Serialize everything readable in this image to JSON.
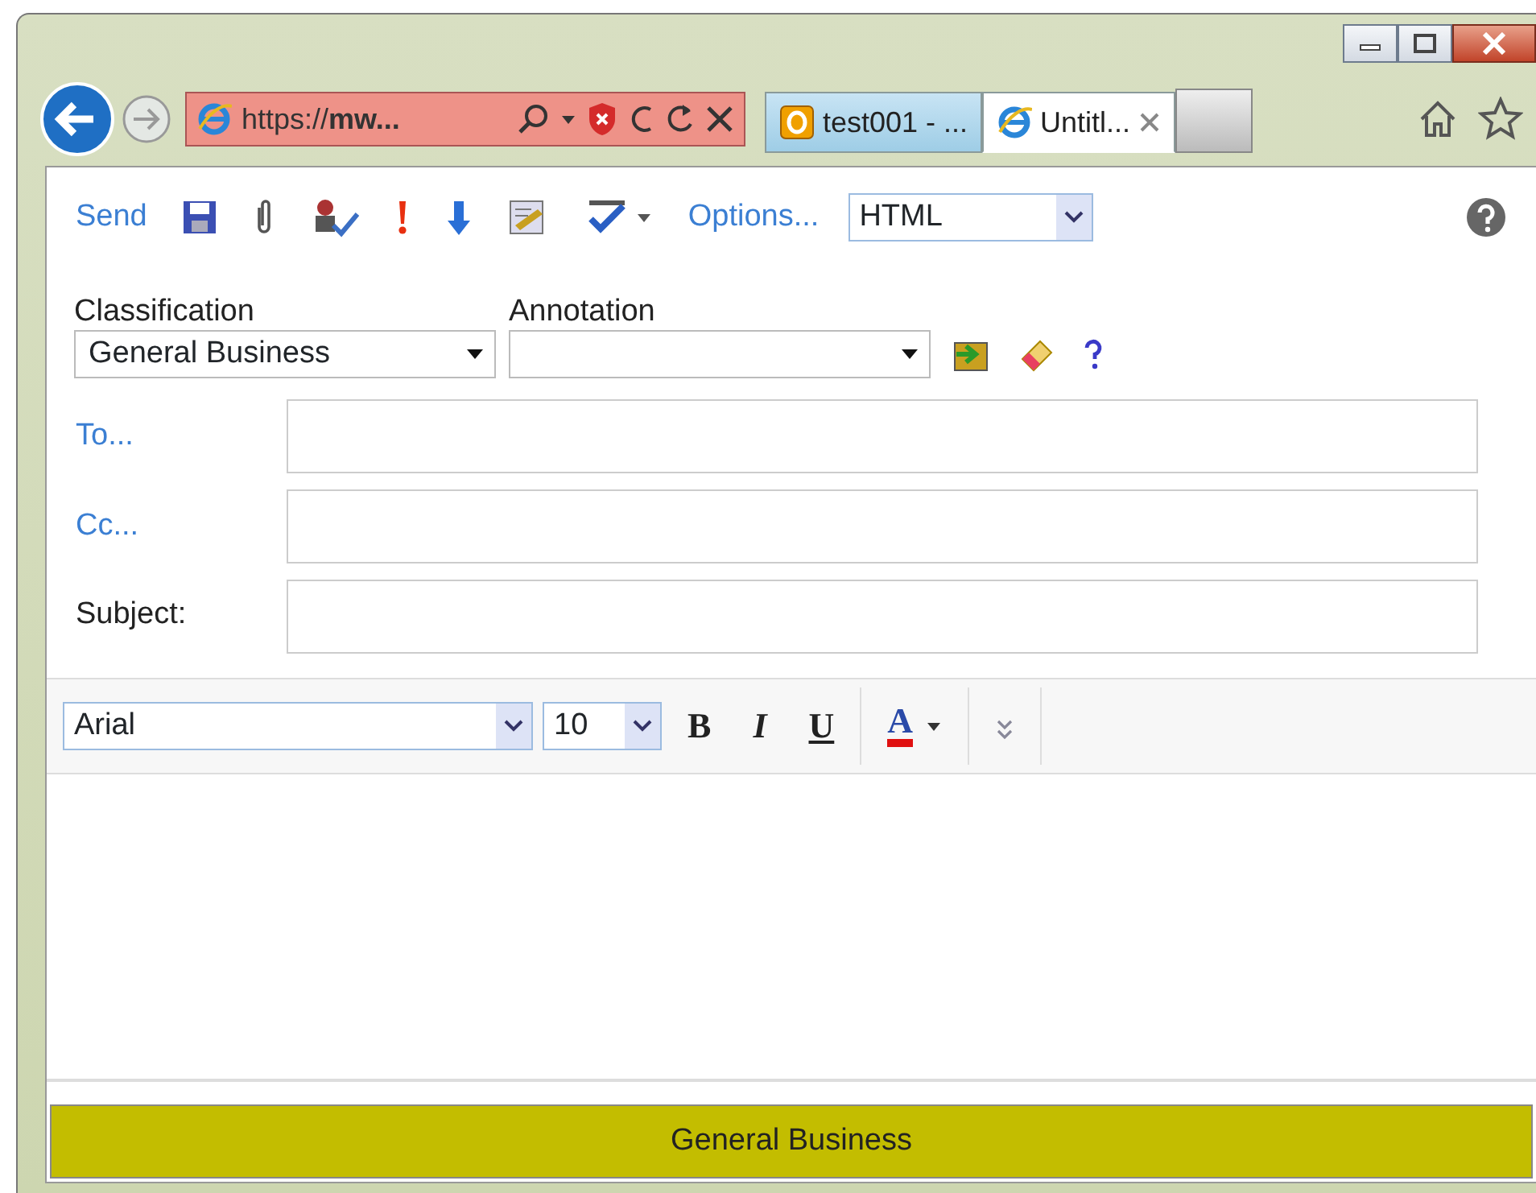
{
  "browser": {
    "address": "https://**mw...**",
    "tabs": [
      {
        "label": "test001 - ...",
        "kind": "outlook",
        "selected": false
      },
      {
        "label": "Untitl...",
        "kind": "ie",
        "selected": true
      }
    ]
  },
  "toolbar": {
    "send": "Send",
    "options": "Options...",
    "format": "HTML"
  },
  "classification": {
    "label": "Classification",
    "value": "General Business"
  },
  "annotation": {
    "label": "Annotation"
  },
  "fields": [
    {
      "label": "To...",
      "kind": "link"
    },
    {
      "label": "Cc...",
      "kind": "link"
    },
    {
      "label": "Subject:",
      "kind": "plain"
    }
  ],
  "formatting": {
    "font": "Arial",
    "size": "10",
    "bold": "B",
    "italic": "I",
    "underline": "U",
    "text_color": "A"
  },
  "banner": "General Business"
}
